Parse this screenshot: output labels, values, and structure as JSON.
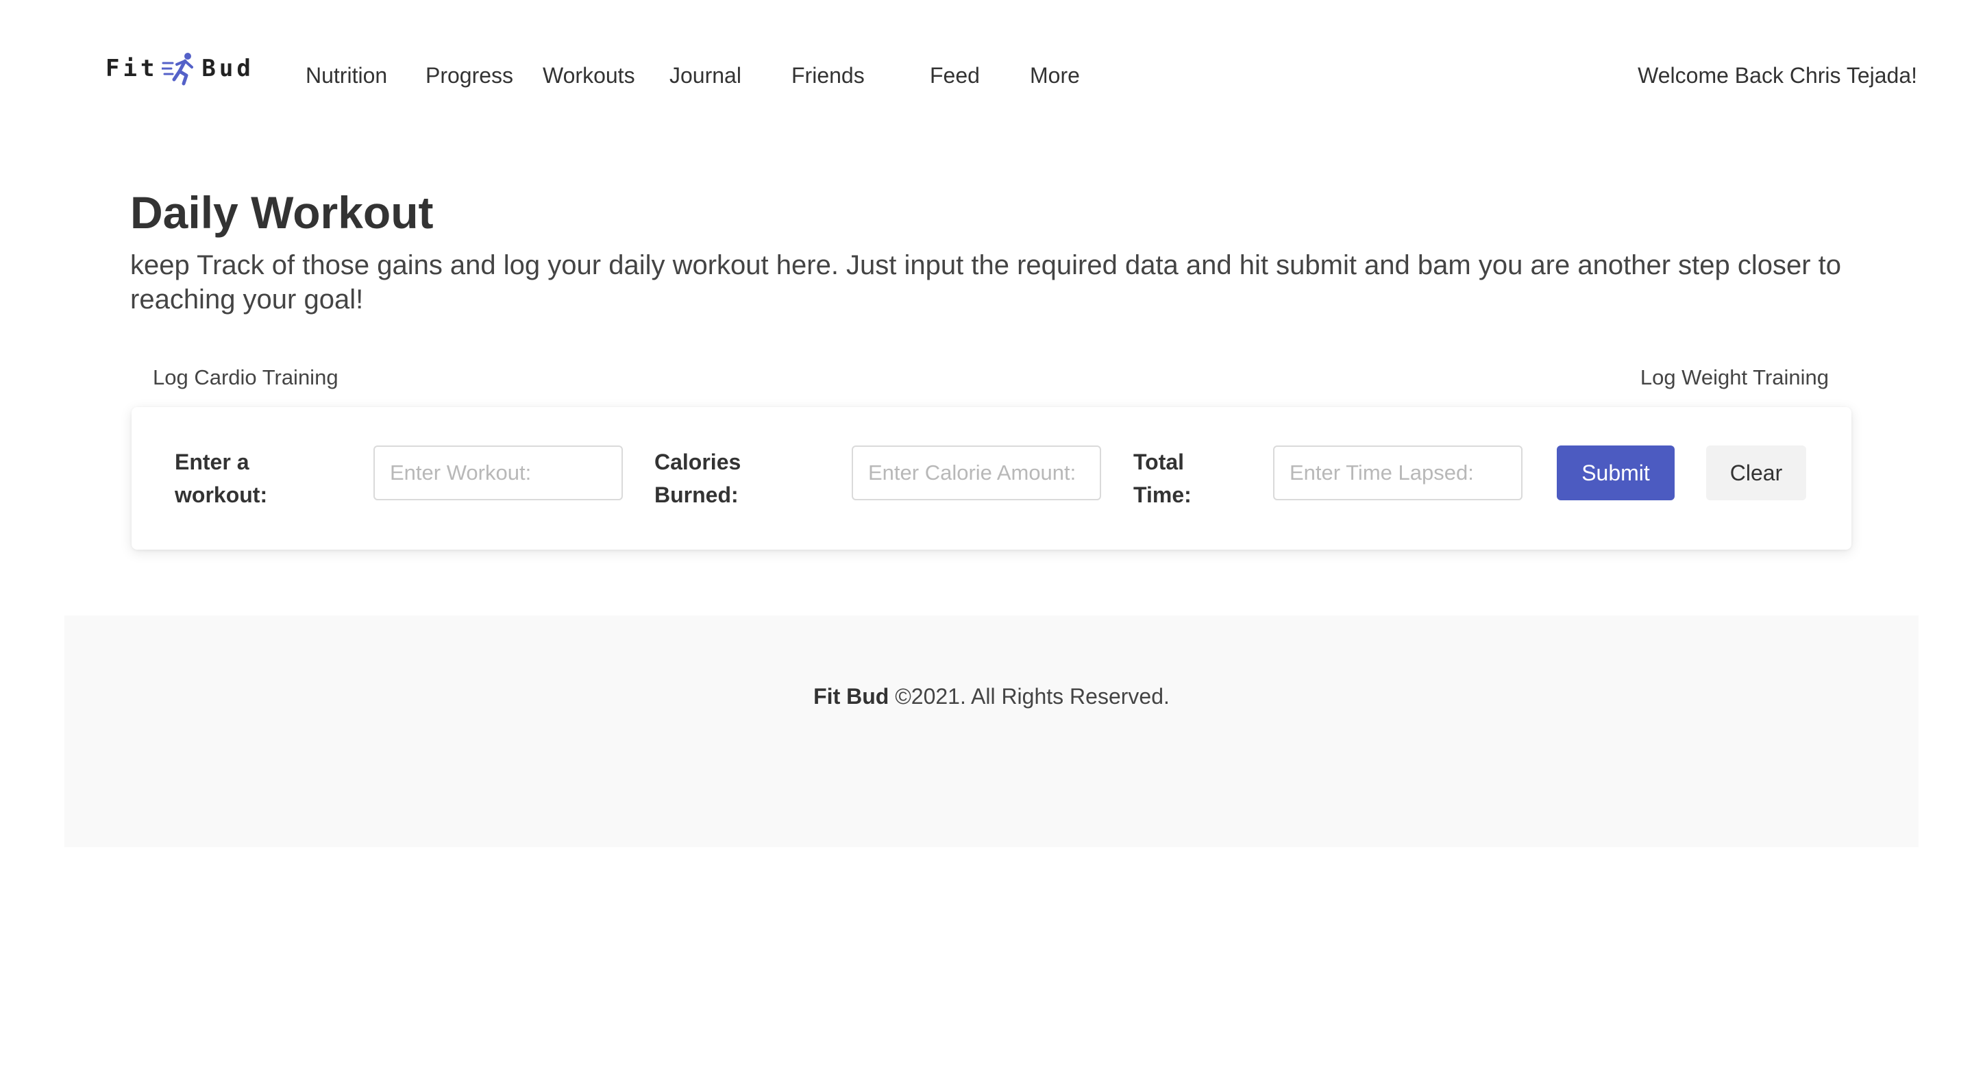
{
  "brand": {
    "name_left": "Fit",
    "name_right": "Bud",
    "icon": "running-person-icon",
    "accent_color": "#5461c8"
  },
  "nav": {
    "items": [
      {
        "label": "Nutrition"
      },
      {
        "label": "Progress"
      },
      {
        "label": "Workouts"
      },
      {
        "label": "Journal"
      },
      {
        "label": "Friends"
      },
      {
        "label": "Feed"
      },
      {
        "label": "More"
      }
    ],
    "welcome": "Welcome Back Chris Tejada!"
  },
  "header": {
    "title": "Daily Workout",
    "subtitle": "keep Track of those gains and log your daily workout here. Just input the required data and hit submit and bam you are another step closer to reaching your goal!"
  },
  "tabs": {
    "cardio": "Log Cardio Training",
    "weight": "Log Weight Training"
  },
  "form": {
    "workout": {
      "label": "Enter a workout:",
      "placeholder": "Enter Workout:",
      "value": ""
    },
    "calories": {
      "label": "Calories Burned:",
      "placeholder": "Enter Calorie Amount:",
      "value": ""
    },
    "time": {
      "label": "Total Time:",
      "placeholder": "Enter Time Lapsed:",
      "value": ""
    },
    "submit_label": "Submit",
    "clear_label": "Clear",
    "submit_color": "#4c5bc1"
  },
  "footer": {
    "brand": "Fit Bud",
    "text": " ©2021. All Rights Reserved."
  }
}
